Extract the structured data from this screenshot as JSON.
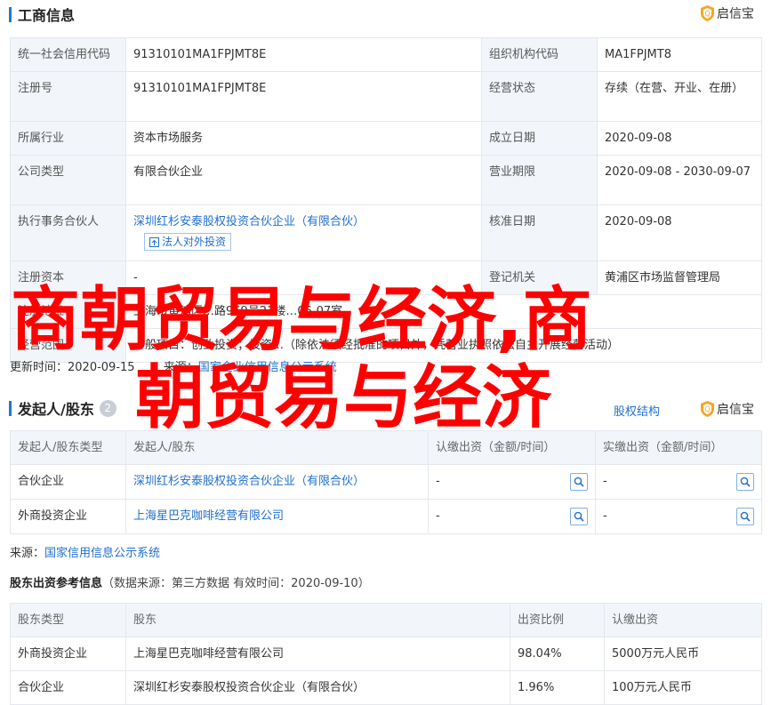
{
  "business_info": {
    "title": "工商信息",
    "badge": "启信宝",
    "rows": [
      {
        "l1": "统一社会信用代码",
        "v1": "91310101MA1FPJMT8E",
        "l2": "组织机构代码",
        "v2": "MA1FPJMT8"
      },
      {
        "l1": "注册号",
        "v1": "91310101MA1FPJMT8E",
        "l2": "经营状态",
        "v2": "存续（在营、开业、在册）"
      },
      {
        "l1": "所属行业",
        "v1": "资本市场服务",
        "l2": "成立日期",
        "v2": "2020-09-08"
      },
      {
        "l1": "公司类型",
        "v1": "有限合伙企业",
        "l2": "营业期限",
        "v2": "2020-09-08 - 2030-09-07"
      },
      {
        "l1": "执行事务合伙人",
        "v1": "深圳红杉安泰股权投资合伙企业（有限合伙）",
        "l2": "核准日期",
        "v2": "2020-09-08"
      },
      {
        "l1": "注册资本",
        "v1": "-",
        "l2": "登记机关",
        "v2": "黄浦区市场监督管理局"
      }
    ],
    "partner_button": "法人对外投资",
    "partial_rows": [
      {
        "l": "注册地址",
        "v": "上海市黄浦区…路969号21楼…06-07室"
      },
      {
        "l": "经营范围",
        "v": "一般项目：创业投资；投资…（除依法须经批准的项目外，凭营业执照依法自主开展经营活动）"
      }
    ],
    "update_label": "更新时间：",
    "update_time": "2020-09-15",
    "source_label": "来源：",
    "source": "国家企业信用信息公示系统"
  },
  "shareholders": {
    "title": "发起人/股东",
    "count": "2",
    "equity_link": "股权结构",
    "badge": "启信宝",
    "headers": [
      "发起人/股东类型",
      "发起人/股东",
      "认缴出资（金额/时间）",
      "实缴出资（金额/时间）"
    ],
    "rows": [
      {
        "type": "合伙企业",
        "name": "深圳红杉安泰股权投资合伙企业（有限合伙）",
        "sub": "-",
        "paid": "-"
      },
      {
        "type": "外商投资企业",
        "name": "上海星巴克咖啡经营有限公司",
        "sub": "-",
        "paid": "-"
      }
    ],
    "source_label": "来源：",
    "source": "国家信用信息公示系统"
  },
  "reference": {
    "title": "股东出资参考信息",
    "meta": "（数据来源：第三方数据 有效时间：2020-09-10）",
    "headers": [
      "股东类型",
      "股东",
      "出资比例",
      "认缴出资"
    ],
    "rows": [
      {
        "type": "外商投资企业",
        "name": "上海星巴克咖啡经营有限公司",
        "ratio": "98.04%",
        "amount": "5000万元人民币"
      },
      {
        "type": "合伙企业",
        "name": "深圳红杉安泰股权投资合伙企业（有限合伙）",
        "ratio": "1.96%",
        "amount": "100万元人民币"
      }
    ]
  },
  "overlay": {
    "line1": "商朝贸易与经济,商",
    "line2": "朝贸易与经济"
  },
  "colors": {
    "accent": "#1a7bd8",
    "link": "#1f6fd0",
    "overlay": "#ff0000",
    "label_bg": "#f2f6fb"
  }
}
